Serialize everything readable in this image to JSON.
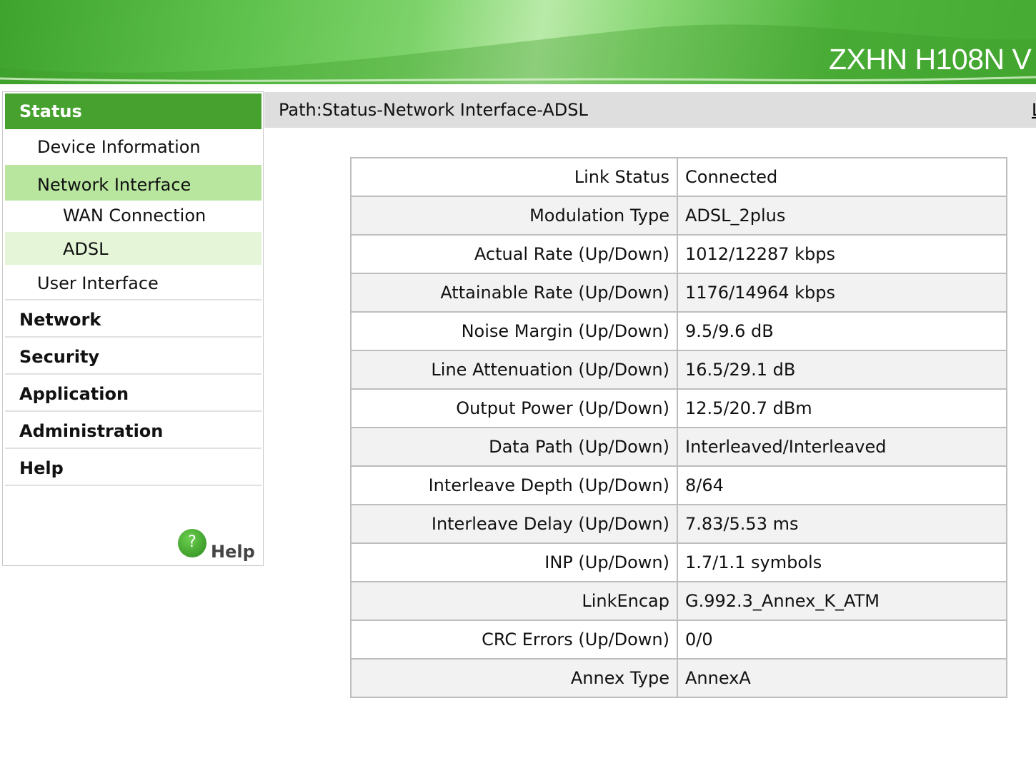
{
  "header": {
    "model": "ZXHN H108N V"
  },
  "sidebar": {
    "status": "Status",
    "device_information": "Device Information",
    "network_interface": "Network Interface",
    "wan_connection": "WAN Connection",
    "adsl": "ADSL",
    "user_interface": "User Interface",
    "network": "Network",
    "security": "Security",
    "application": "Application",
    "administration": "Administration",
    "help": "Help",
    "help_link": "Help",
    "help_icon": "question-icon"
  },
  "path": {
    "text": "Path:Status-Network Interface-ADSL",
    "logout_fragment": "L"
  },
  "adsl": {
    "rows": [
      {
        "label": "Link Status",
        "value": "Connected"
      },
      {
        "label": "Modulation Type",
        "value": "ADSL_2plus"
      },
      {
        "label": "Actual Rate (Up/Down)",
        "value": "1012/12287 kbps"
      },
      {
        "label": "Attainable Rate (Up/Down)",
        "value": "1176/14964 kbps"
      },
      {
        "label": "Noise Margin (Up/Down)",
        "value": "9.5/9.6 dB"
      },
      {
        "label": "Line Attenuation (Up/Down)",
        "value": "16.5/29.1 dB"
      },
      {
        "label": "Output Power (Up/Down)",
        "value": "12.5/20.7 dBm"
      },
      {
        "label": "Data Path (Up/Down)",
        "value": "Interleaved/Interleaved"
      },
      {
        "label": "Interleave Depth (Up/Down)",
        "value": "8/64"
      },
      {
        "label": "Interleave Delay (Up/Down)",
        "value": "7.83/5.53 ms"
      },
      {
        "label": "INP (Up/Down)",
        "value": "1.7/1.1 symbols"
      },
      {
        "label": "LinkEncap",
        "value": "G.992.3_Annex_K_ATM"
      },
      {
        "label": "CRC Errors (Up/Down)",
        "value": "0/0"
      },
      {
        "label": "Annex Type",
        "value": "AnnexA"
      }
    ]
  },
  "colors": {
    "brand_green": "#47a12f",
    "selected_light": "#b8e69e",
    "selected_lighter": "#e4f5d8",
    "path_bar": "#dedede"
  }
}
